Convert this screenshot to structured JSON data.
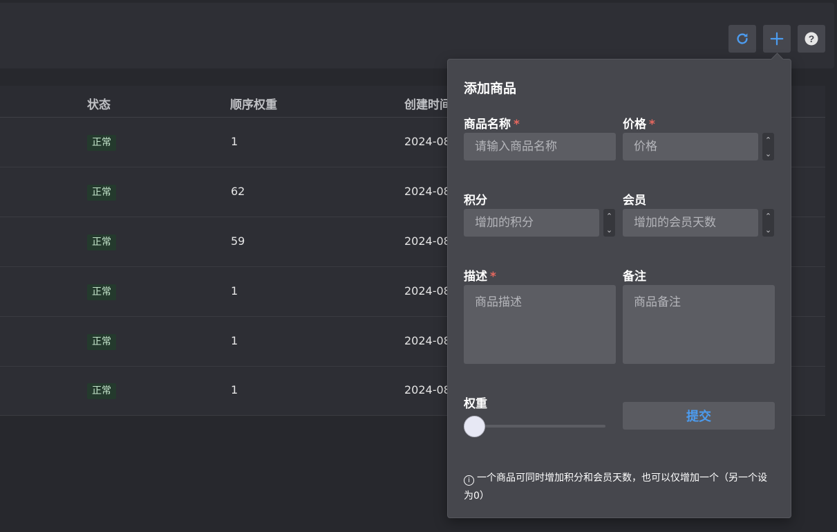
{
  "toolbar": {
    "refresh_icon": "refresh-icon",
    "add_icon": "plus-icon",
    "help_icon": "help-icon",
    "help_glyph": "?"
  },
  "table": {
    "columns": [
      "状态",
      "顺序权重",
      "创建时间"
    ],
    "rows": [
      {
        "status": "正常",
        "weight": "1",
        "created": "2024-08"
      },
      {
        "status": "正常",
        "weight": "62",
        "created": "2024-08"
      },
      {
        "status": "正常",
        "weight": "59",
        "created": "2024-08"
      },
      {
        "status": "正常",
        "weight": "1",
        "created": "2024-08"
      },
      {
        "status": "正常",
        "weight": "1",
        "created": "2024-08"
      },
      {
        "status": "正常",
        "weight": "1",
        "created": "2024-08"
      }
    ]
  },
  "form": {
    "title": "添加商品",
    "required_mark": "*",
    "name": {
      "label": "商品名称",
      "placeholder": "请输入商品名称"
    },
    "price": {
      "label": "价格",
      "placeholder": "价格"
    },
    "points": {
      "label": "积分",
      "placeholder": "增加的积分"
    },
    "membership": {
      "label": "会员",
      "placeholder": "增加的会员天数"
    },
    "description": {
      "label": "描述",
      "placeholder": "商品描述"
    },
    "remark": {
      "label": "备注",
      "placeholder": "商品备注"
    },
    "weight": {
      "label": "权重",
      "value": 0
    },
    "submit_label": "提交",
    "spin_up": "⌃",
    "spin_down": "⌄",
    "info_glyph": "i",
    "note": "一个商品可同时增加积分和会员天数，也可以仅增加一个（另一个设为0）"
  },
  "colors": {
    "accent": "#4c9cf0",
    "required": "#e8685f",
    "tag_bg": "#243a2d",
    "tag_text": "#c6e7cd"
  }
}
